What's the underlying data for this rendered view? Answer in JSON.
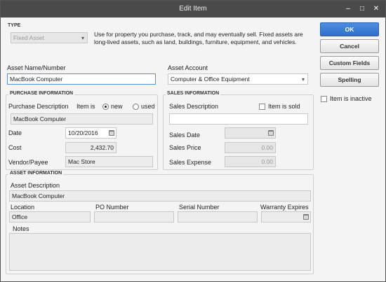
{
  "window": {
    "title": "Edit Item",
    "minimize": "–",
    "maximize": "□",
    "close": "✕"
  },
  "type": {
    "group_label": "TYPE",
    "selected": "Fixed Asset",
    "description": "Use for property you purchase, track, and may eventually sell.  Fixed assets are long-lived assets, such as land, buildings, furniture, equipment, and vehicles."
  },
  "asset_name": {
    "label": "Asset Name/Number",
    "value": "MacBook Computer"
  },
  "asset_account": {
    "label": "Asset Account",
    "value": "Computer & Office Equipment"
  },
  "purchase": {
    "group_label": "PURCHASE INFORMATION",
    "description_label": "Purchase Description",
    "item_is_label": "Item is",
    "new_label": "new",
    "used_label": "used",
    "description_value": "MacBook Computer",
    "date_label": "Date",
    "date_value": "10/20/2016",
    "cost_label": "Cost",
    "cost_value": "2,432.70",
    "vendor_label": "Vendor/Payee",
    "vendor_value": "Mac Store"
  },
  "sales": {
    "group_label": "SALES INFORMATION",
    "description_label": "Sales Description",
    "item_sold_label": "Item is sold",
    "description_value": "",
    "date_label": "Sales Date",
    "date_value": "",
    "price_label": "Sales Price",
    "price_value": "0.00",
    "expense_label": "Sales Expense",
    "expense_value": "0.00"
  },
  "asset_info": {
    "group_label": "ASSET INFORMATION",
    "description_label": "Asset Description",
    "description_value": "MacBook Computer",
    "location_label": "Location",
    "location_value": "Office",
    "po_label": "PO Number",
    "po_value": "",
    "serial_label": "Serial Number",
    "serial_value": "",
    "warranty_label": "Warranty Expires",
    "warranty_value": "",
    "notes_label": "Notes",
    "notes_value": ""
  },
  "buttons": {
    "ok": "OK",
    "cancel": "Cancel",
    "custom_fields": "Custom Fields",
    "spelling": "Spelling"
  },
  "inactive": {
    "label": "Item is inactive"
  }
}
